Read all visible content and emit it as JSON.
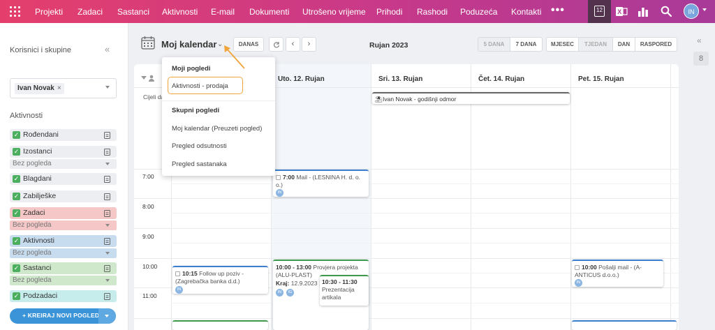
{
  "nav": {
    "items": [
      "Projekti",
      "Zadaci",
      "Sastanci",
      "Aktivnosti",
      "E-mail",
      "Dokumenti",
      "Utrošeno vrijeme",
      "Prihodi",
      "Rashodi",
      "Poduzeća",
      "Kontakti"
    ],
    "more": "•••",
    "calendar_day": "12",
    "avatar_initials": "IN",
    "icons": [
      "apps-grid-icon",
      "calendar-icon",
      "excel-icon",
      "bar-chart-icon",
      "search-icon"
    ]
  },
  "sidebar": {
    "title": "Korisnici i skupine",
    "collapse": "«",
    "user_chip": "Ivan Novak",
    "user_chip_remove": "×",
    "activities_title": "Aktivnosti",
    "items": [
      {
        "label": "Rođendani",
        "color": "#eceef1"
      },
      {
        "label": "Izostanci",
        "color": "#eceef1",
        "sub": "Bez pogleda"
      },
      {
        "label": "Blagdani",
        "color": "#eceef1"
      },
      {
        "label": "Zabilješke",
        "color": "#eceef1"
      },
      {
        "label": "Zadaci",
        "color": "#f5c7c7",
        "sub": "Bez pogleda"
      },
      {
        "label": "Aktivnosti",
        "color": "#c8dcef",
        "sub": "Bez pogleda"
      },
      {
        "label": "Sastanci",
        "color": "#cfe8cc",
        "sub": "Bez pogleda"
      },
      {
        "label": "Podzadaci",
        "color": "#c6ecec"
      }
    ],
    "create_button": "+ KREIRAJ NOVI POGLED"
  },
  "toolbar": {
    "title": "Moj kalendar",
    "today": "DANAS",
    "month": "Rujan 2023",
    "views": [
      "5 DANA",
      "7 DANA",
      "MJESEC",
      "TJEDAN",
      "DAN",
      "RASPORED"
    ]
  },
  "calendar": {
    "days": [
      "Uto. 12. Rujan",
      "Sri. 13. Rujan",
      "Čet. 14. Rujan",
      "Pet. 15. Rujan"
    ],
    "allday_label": "Cijeli da",
    "hours": [
      "7:00",
      "8:00",
      "9:00",
      "10:00",
      "11:00"
    ],
    "allday_event": "Ivan Novak - godišnji odmor",
    "events": [
      {
        "time": "7:00",
        "text": "Mail - (LESNINA H. d. o. o.)",
        "avatar": "IN",
        "color": "#3b7fd0"
      },
      {
        "time": "10:15",
        "text": "Follow up poziv - (Zagrebačka banka d.d.)",
        "avatar": "IN",
        "color": "#3b7fd0"
      },
      {
        "time": "10:00 - 13:00",
        "text": "Provjera projekta (ALU-PLAST)",
        "extra_label": "Kraj:",
        "extra_value": "12.9.2023 1",
        "avatars": [
          "IN",
          "IG"
        ],
        "color": "#3d9a4a"
      },
      {
        "time": "10:30 - 11:30",
        "text": "Prezentacija artikala",
        "color": "#3d9a4a"
      },
      {
        "time": "10:00",
        "text": "Pošalji mail - (A-ANTICUS d.o.o.)",
        "avatar": "IN",
        "color": "#3b7fd0"
      }
    ]
  },
  "dropdown": {
    "my_views_header": "Moji pogledi",
    "my_views": [
      "Aktivnosti - prodaja"
    ],
    "shared_header": "Skupni pogledi",
    "shared_views": [
      "Moj kalendar (Preuzeti pogled)",
      "Pregled odsutnosti",
      "Pregled sastanaka"
    ],
    "highlight_color": "#f0a43a"
  },
  "right_panel": {
    "collapse": "«",
    "badge": "8"
  }
}
